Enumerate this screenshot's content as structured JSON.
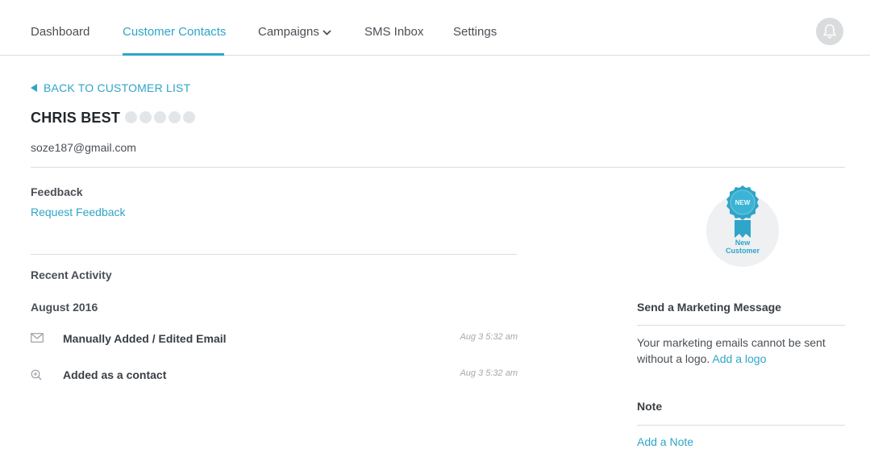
{
  "nav": {
    "items": [
      {
        "label": "Dashboard"
      },
      {
        "label": "Customer Contacts",
        "active": true
      },
      {
        "label": "Campaigns"
      },
      {
        "label": "SMS Inbox"
      },
      {
        "label": "Settings"
      }
    ],
    "accent_color": "#2fa5c8",
    "notification_icon": "bell-icon"
  },
  "back_link": {
    "label": "BACK TO CUSTOMER LIST",
    "icon": "triangle-left-icon"
  },
  "customer": {
    "name": "CHRIS BEST",
    "email": "soze187@gmail.com",
    "rating": {
      "value": 0,
      "max": 5
    }
  },
  "feedback": {
    "title": "Feedback",
    "link": "Request Feedback"
  },
  "activity": {
    "title": "Recent Activity",
    "month": "August 2016",
    "items": [
      {
        "icon": "envelope-icon",
        "text": "Manually Added / Edited Email",
        "time": "Aug 3 5:32 am"
      },
      {
        "icon": "zoom-in-icon",
        "text": "Added as a contact",
        "time": "Aug 3 5:32 am"
      }
    ]
  },
  "badge": {
    "ribbon_text": "NEW",
    "label": "New\nCustomer",
    "icon": "award-ribbon-icon"
  },
  "marketing": {
    "title": "Send a Marketing Message",
    "text": "Your marketing emails cannot be sent without a logo.",
    "link": "Add a logo"
  },
  "note": {
    "title": "Note",
    "link": "Add a Note"
  }
}
